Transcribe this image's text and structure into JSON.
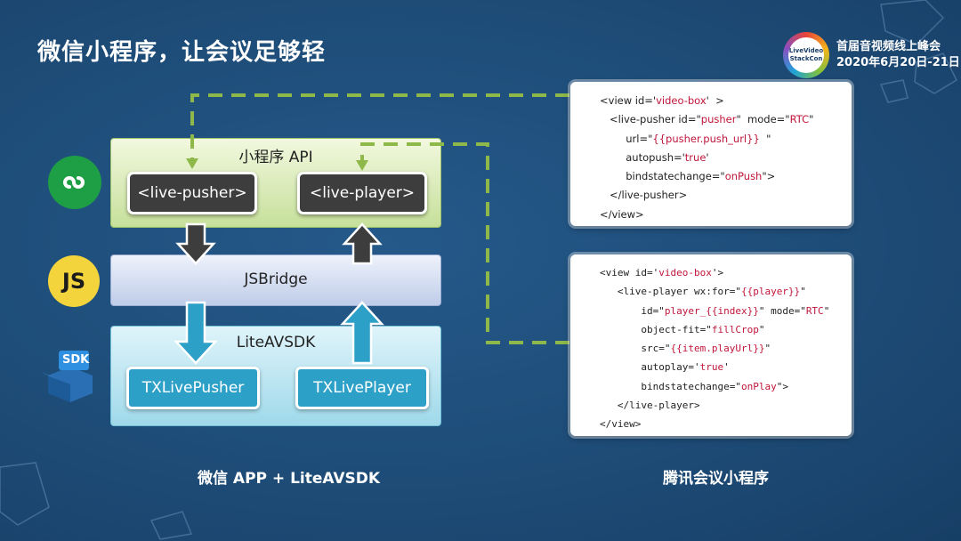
{
  "slide": {
    "title": "微信小程序，让会议足够轻",
    "logo_text": "LiveVideo StackCon",
    "event_name": "首届音视频线上峰会",
    "event_date": "2020年6月20日-21日"
  },
  "diagram": {
    "api_label": "小程序 API",
    "live_pusher": "<live-pusher>",
    "live_player": "<live-player>",
    "bridge_label": "JSBridge",
    "sdk_label": "LiteAVSDK",
    "tx_pusher": "TXLivePusher",
    "tx_player": "TXLivePlayer",
    "js_icon_text": "JS",
    "sdk_icon_text": "SDK"
  },
  "code1": [
    [
      {
        "t": "<view id='"
      },
      {
        "t": "video-box",
        "k": true
      },
      {
        "t": "'  >"
      }
    ],
    [
      {
        "t": "   <live-pusher id=\""
      },
      {
        "t": "pusher",
        "k": true
      },
      {
        "t": "\"  mode=\""
      },
      {
        "t": "RTC",
        "k": true
      },
      {
        "t": "\""
      }
    ],
    [
      {
        "t": "        url=\""
      },
      {
        "t": "{{pusher.push_url}}",
        "k": true
      },
      {
        "t": "  \""
      }
    ],
    [
      {
        "t": "        autopush='"
      },
      {
        "t": "true",
        "k": true
      },
      {
        "t": "'"
      }
    ],
    [
      {
        "t": "        bindstatechange=\""
      },
      {
        "t": "onPush",
        "k": true
      },
      {
        "t": "\">"
      }
    ],
    [
      {
        "t": "   </live-pusher>"
      }
    ],
    [
      {
        "t": "</view>"
      }
    ]
  ],
  "code2": [
    [
      {
        "t": "<view id='"
      },
      {
        "t": "video-box",
        "k": true
      },
      {
        "t": "'>"
      }
    ],
    [
      {
        "t": "   <live-player wx:for=\""
      },
      {
        "t": "{{player}}",
        "k": true
      },
      {
        "t": "\""
      }
    ],
    [
      {
        "t": "       id=\""
      },
      {
        "t": "player_{{index}}",
        "k": true
      },
      {
        "t": "\" mode=\""
      },
      {
        "t": "RTC",
        "k": true
      },
      {
        "t": "\""
      }
    ],
    [
      {
        "t": "       object-fit=\""
      },
      {
        "t": "fillCrop",
        "k": true
      },
      {
        "t": "\""
      }
    ],
    [
      {
        "t": "       src=\""
      },
      {
        "t": "{{item.playUrl}}",
        "k": true
      },
      {
        "t": "\""
      }
    ],
    [
      {
        "t": "       autoplay='"
      },
      {
        "t": "true",
        "k": true
      },
      {
        "t": "'"
      }
    ],
    [
      {
        "t": "       bindstatechange=\""
      },
      {
        "t": "onPlay",
        "k": true
      },
      {
        "t": "\">"
      }
    ],
    [
      {
        "t": "   </live-player>"
      }
    ],
    [
      {
        "t": "</view>"
      }
    ]
  ],
  "captions": {
    "left": "微信 APP + LiteAVSDK",
    "right": "腾讯会议小程序"
  },
  "colors": {
    "dash_line": "#8fb84a",
    "background": "#1f4f7a"
  }
}
